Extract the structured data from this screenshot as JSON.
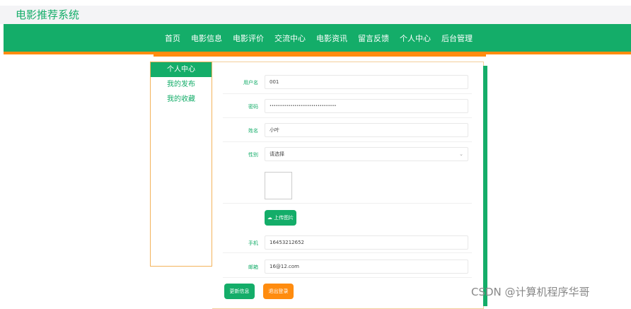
{
  "header": {
    "title": "电影推荐系统"
  },
  "nav": [
    "首页",
    "电影信息",
    "电影评价",
    "交流中心",
    "电影资讯",
    "留言反馈",
    "个人中心",
    "后台管理"
  ],
  "sidebar": [
    "个人中心",
    "我的发布",
    "我的收藏"
  ],
  "form": {
    "username": {
      "label": "用户名",
      "value": "001"
    },
    "password": {
      "label": "密码",
      "value": "••••••••••••••••••••••••••••••••"
    },
    "name": {
      "label": "姓名",
      "value": "小叶"
    },
    "gender": {
      "label": "性别",
      "value": "请选择"
    },
    "upload": "上传图片",
    "phone": {
      "label": "手机",
      "value": "16453212652"
    },
    "email": {
      "label": "邮箱",
      "value": "16@12.com"
    },
    "update": "更新信息",
    "logout": "退出登录"
  },
  "watermark": "CSDN @计算机程序华哥",
  "colors": {
    "green": "#14ad69",
    "orange": "#ff8c0f"
  }
}
